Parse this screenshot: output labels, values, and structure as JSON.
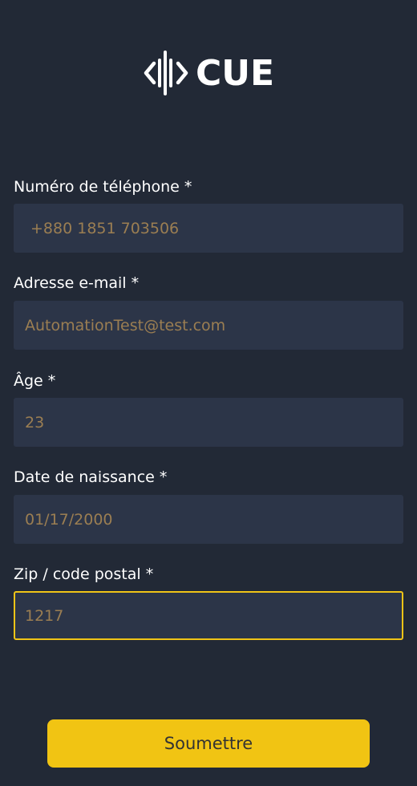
{
  "brand": {
    "name": "CUE",
    "icon": "cue-logo-icon"
  },
  "form": {
    "phone": {
      "label": "Numéro de téléphone *",
      "value": "+880 1851 703506"
    },
    "email": {
      "label": "Adresse e-mail *",
      "value": "AutomationTest@test.com"
    },
    "age": {
      "label": "Âge *",
      "value": "23"
    },
    "birthdate": {
      "label": "Date de naissance *",
      "value": "01/17/2000"
    },
    "zip": {
      "label": "Zip / code postal *",
      "value": "1217"
    }
  },
  "submit_label": "Soumettre",
  "colors": {
    "background": "#222936",
    "input_background": "#2c3548",
    "value_text": "#9b7e52",
    "accent": "#f1c413"
  }
}
